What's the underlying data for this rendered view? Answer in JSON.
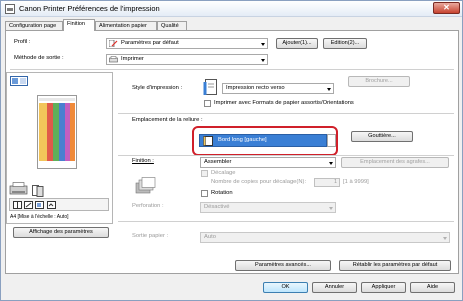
{
  "window": {
    "title": "Canon Printer Préférences de l'impression",
    "close_glyph": "✕"
  },
  "tabs": [
    {
      "label": "Configuration page"
    },
    {
      "label": "Finition"
    },
    {
      "label": "Alimentation papier"
    },
    {
      "label": "Qualité"
    }
  ],
  "profile": {
    "label": "Profil :",
    "value": "Paramètres par défaut",
    "add_button": "Ajouter(1)...",
    "edit_button": "Edition(2)..."
  },
  "output_method": {
    "label": "Méthode de sortie :",
    "value": "Imprimer"
  },
  "preview": {
    "caption": "A4 [Mise à l'échelle : Auto]"
  },
  "print_style": {
    "label": "Style d'impression :",
    "value": "Impression recto verso",
    "brochure_button": "Brochure..."
  },
  "mixed_checkbox": {
    "label": "Imprimer avec Formats de papier assortis/Orientations",
    "checked": false
  },
  "binding": {
    "label": "Emplacement de la reliure :",
    "value": "Bord long [gauche]",
    "gutter_button": "Gouttière..."
  },
  "finishing": {
    "label": "Finition :",
    "value": "Assembler",
    "staple_button": "Emplacement des agrafes..."
  },
  "offset": {
    "label": "Décalage",
    "copies_label": "Nombre de copies pour décalage(N):",
    "copies_value": "1",
    "range": "[1 à 9999]"
  },
  "rotation": {
    "label": "Rotation",
    "checked": false
  },
  "perforation": {
    "label": "Perforation :",
    "value": "Désactivé"
  },
  "output_paper": {
    "label": "Sortie papier :",
    "value": "Auto"
  },
  "show_settings_button": "Affichage des paramètres",
  "advanced_button": "Paramètres avancés...",
  "restore_button": "Rétablir les paramètres par défaut",
  "footer": {
    "ok": "OK",
    "cancel": "Annuler",
    "apply": "Appliquer",
    "help": "Aide"
  },
  "colors": {
    "highlight_ring": "#d0202a",
    "selection_blue": "#3a7fd5",
    "accent_border": "#3c7fb1"
  }
}
